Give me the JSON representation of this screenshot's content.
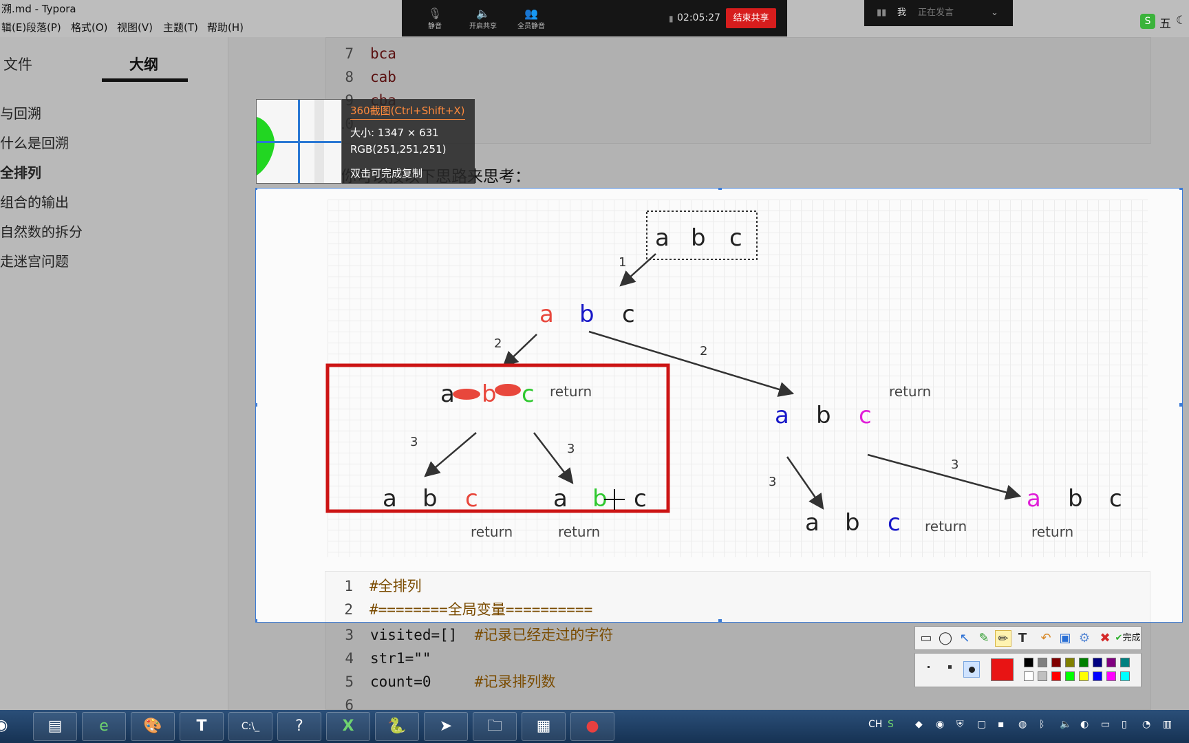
{
  "window": {
    "title": "溯.md - Typora"
  },
  "menu": [
    "辑(E)",
    "段落(P)",
    "格式(O)",
    "视图(V)",
    "主题(T)",
    "帮助(H)"
  ],
  "sidebar": {
    "tabs": [
      "文件",
      "大纲"
    ],
    "outline": [
      "与回溯",
      "什么是回溯",
      "全排列",
      "组合的输出",
      "自然数的拆分",
      "走迷宫问题"
    ]
  },
  "code_top": {
    "lines": [
      {
        "n": "7",
        "text": "bca"
      },
      {
        "n": "8",
        "text": "cab"
      },
      {
        "n": "9",
        "text": "cba"
      },
      {
        "n": "10",
        "text": ""
      }
    ]
  },
  "paragraph": "你可以按以下思路来思考：",
  "tooltip": {
    "title": "360截图(Ctrl+Shift+X)",
    "size": "大小: 1347 × 631",
    "rgb": "RGB(251,251,251)",
    "hint": "双击可完成复制"
  },
  "tree": {
    "root": [
      "a",
      "b",
      "c"
    ],
    "edge_labels": [
      "1",
      "2",
      "2",
      "3",
      "3",
      "3",
      "3"
    ],
    "return_label": "return"
  },
  "code_bottom": {
    "lines": [
      {
        "n": "1",
        "text": "#全排列",
        "type": "comment"
      },
      {
        "n": "2",
        "text": "#========全局变量==========",
        "type": "comment"
      },
      {
        "n": "3",
        "code": "visited=[]  ",
        "comment": "#记录已经走过的字符"
      },
      {
        "n": "4",
        "code": "str1=\"\"",
        "comment": ""
      },
      {
        "n": "5",
        "code": "count=0     ",
        "comment": "#记录排列数"
      },
      {
        "n": "6",
        "code": "",
        "comment": ""
      }
    ]
  },
  "meeting": {
    "items": [
      "静音",
      "开启共享",
      "全员静音"
    ],
    "time": "02:05:27",
    "end_label": "结束共享",
    "speaker_name": "我",
    "speaker_status": "正在发言"
  },
  "ime": {
    "label": "五"
  },
  "toolbar": {
    "done_label": "完成"
  },
  "tray": {
    "lang": "CH"
  },
  "colors": {
    "red": "#e8473c",
    "blue": "#1818c8",
    "green": "#2fc82f",
    "magenta": "#e020d8",
    "box_red": "#cc1414"
  }
}
